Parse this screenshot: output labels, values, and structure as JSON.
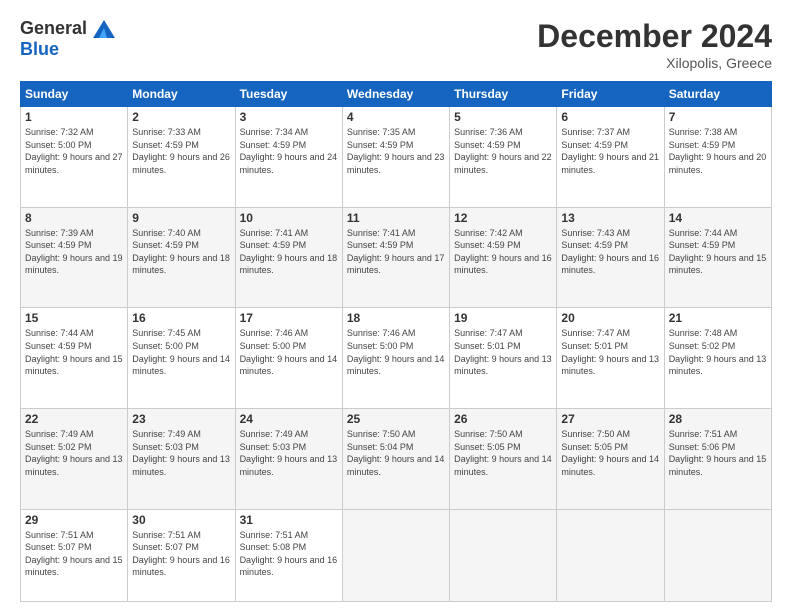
{
  "header": {
    "logo_line1": "General",
    "logo_line2": "Blue",
    "month": "December 2024",
    "location": "Xilopolis, Greece"
  },
  "weekdays": [
    "Sunday",
    "Monday",
    "Tuesday",
    "Wednesday",
    "Thursday",
    "Friday",
    "Saturday"
  ],
  "weeks": [
    [
      {
        "day": "1",
        "sunrise": "7:32 AM",
        "sunset": "5:00 PM",
        "daylight": "9 hours and 27 minutes."
      },
      {
        "day": "2",
        "sunrise": "7:33 AM",
        "sunset": "4:59 PM",
        "daylight": "9 hours and 26 minutes."
      },
      {
        "day": "3",
        "sunrise": "7:34 AM",
        "sunset": "4:59 PM",
        "daylight": "9 hours and 24 minutes."
      },
      {
        "day": "4",
        "sunrise": "7:35 AM",
        "sunset": "4:59 PM",
        "daylight": "9 hours and 23 minutes."
      },
      {
        "day": "5",
        "sunrise": "7:36 AM",
        "sunset": "4:59 PM",
        "daylight": "9 hours and 22 minutes."
      },
      {
        "day": "6",
        "sunrise": "7:37 AM",
        "sunset": "4:59 PM",
        "daylight": "9 hours and 21 minutes."
      },
      {
        "day": "7",
        "sunrise": "7:38 AM",
        "sunset": "4:59 PM",
        "daylight": "9 hours and 20 minutes."
      }
    ],
    [
      {
        "day": "8",
        "sunrise": "7:39 AM",
        "sunset": "4:59 PM",
        "daylight": "9 hours and 19 minutes."
      },
      {
        "day": "9",
        "sunrise": "7:40 AM",
        "sunset": "4:59 PM",
        "daylight": "9 hours and 18 minutes."
      },
      {
        "day": "10",
        "sunrise": "7:41 AM",
        "sunset": "4:59 PM",
        "daylight": "9 hours and 18 minutes."
      },
      {
        "day": "11",
        "sunrise": "7:41 AM",
        "sunset": "4:59 PM",
        "daylight": "9 hours and 17 minutes."
      },
      {
        "day": "12",
        "sunrise": "7:42 AM",
        "sunset": "4:59 PM",
        "daylight": "9 hours and 16 minutes."
      },
      {
        "day": "13",
        "sunrise": "7:43 AM",
        "sunset": "4:59 PM",
        "daylight": "9 hours and 16 minutes."
      },
      {
        "day": "14",
        "sunrise": "7:44 AM",
        "sunset": "4:59 PM",
        "daylight": "9 hours and 15 minutes."
      }
    ],
    [
      {
        "day": "15",
        "sunrise": "7:44 AM",
        "sunset": "4:59 PM",
        "daylight": "9 hours and 15 minutes."
      },
      {
        "day": "16",
        "sunrise": "7:45 AM",
        "sunset": "5:00 PM",
        "daylight": "9 hours and 14 minutes."
      },
      {
        "day": "17",
        "sunrise": "7:46 AM",
        "sunset": "5:00 PM",
        "daylight": "9 hours and 14 minutes."
      },
      {
        "day": "18",
        "sunrise": "7:46 AM",
        "sunset": "5:00 PM",
        "daylight": "9 hours and 14 minutes."
      },
      {
        "day": "19",
        "sunrise": "7:47 AM",
        "sunset": "5:01 PM",
        "daylight": "9 hours and 13 minutes."
      },
      {
        "day": "20",
        "sunrise": "7:47 AM",
        "sunset": "5:01 PM",
        "daylight": "9 hours and 13 minutes."
      },
      {
        "day": "21",
        "sunrise": "7:48 AM",
        "sunset": "5:02 PM",
        "daylight": "9 hours and 13 minutes."
      }
    ],
    [
      {
        "day": "22",
        "sunrise": "7:49 AM",
        "sunset": "5:02 PM",
        "daylight": "9 hours and 13 minutes."
      },
      {
        "day": "23",
        "sunrise": "7:49 AM",
        "sunset": "5:03 PM",
        "daylight": "9 hours and 13 minutes."
      },
      {
        "day": "24",
        "sunrise": "7:49 AM",
        "sunset": "5:03 PM",
        "daylight": "9 hours and 13 minutes."
      },
      {
        "day": "25",
        "sunrise": "7:50 AM",
        "sunset": "5:04 PM",
        "daylight": "9 hours and 14 minutes."
      },
      {
        "day": "26",
        "sunrise": "7:50 AM",
        "sunset": "5:05 PM",
        "daylight": "9 hours and 14 minutes."
      },
      {
        "day": "27",
        "sunrise": "7:50 AM",
        "sunset": "5:05 PM",
        "daylight": "9 hours and 14 minutes."
      },
      {
        "day": "28",
        "sunrise": "7:51 AM",
        "sunset": "5:06 PM",
        "daylight": "9 hours and 15 minutes."
      }
    ],
    [
      {
        "day": "29",
        "sunrise": "7:51 AM",
        "sunset": "5:07 PM",
        "daylight": "9 hours and 15 minutes."
      },
      {
        "day": "30",
        "sunrise": "7:51 AM",
        "sunset": "5:07 PM",
        "daylight": "9 hours and 16 minutes."
      },
      {
        "day": "31",
        "sunrise": "7:51 AM",
        "sunset": "5:08 PM",
        "daylight": "9 hours and 16 minutes."
      },
      null,
      null,
      null,
      null
    ]
  ]
}
